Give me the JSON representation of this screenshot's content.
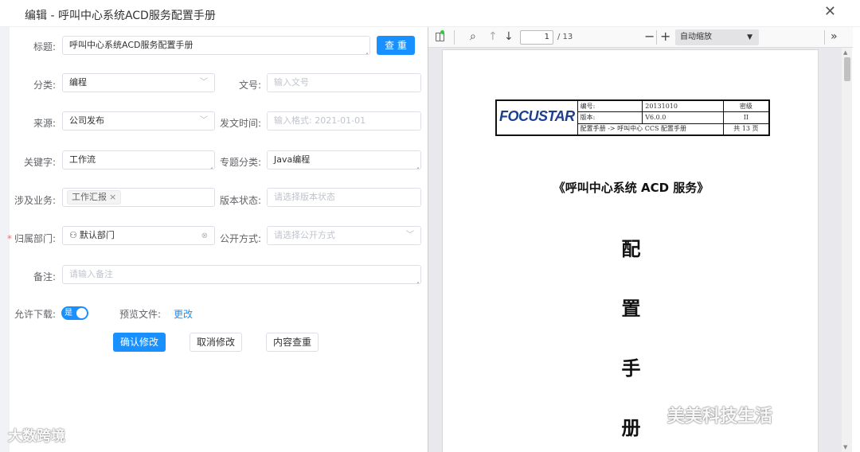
{
  "dialog": {
    "title": "编辑 - 呼叫中心系统ACD服务配置手册",
    "close_icon": "close-icon"
  },
  "form": {
    "title": {
      "label": "标题:",
      "value": "呼叫中心系统ACD服务配置手册",
      "button": "查 重"
    },
    "category": {
      "label": "分类:",
      "value": "编程"
    },
    "doc_no": {
      "label": "文号:",
      "placeholder": "输入文号"
    },
    "source": {
      "label": "来源:",
      "value": "公司发布"
    },
    "publish_time": {
      "label": "发文时间:",
      "placeholder": "输入格式: 2021-01-01"
    },
    "keywords": {
      "label": "关键字:",
      "value": "工作流"
    },
    "topic": {
      "label": "专题分类:",
      "value": "Java编程"
    },
    "business": {
      "label": "涉及业务:",
      "tag": "工作汇报"
    },
    "version_status": {
      "label": "版本状态:",
      "placeholder": "请选择版本状态"
    },
    "department": {
      "label": "归属部门:",
      "value": "默认部门",
      "required_mark": "*"
    },
    "visibility": {
      "label": "公开方式:",
      "placeholder": "请选择公开方式"
    },
    "remark": {
      "label": "备注:",
      "placeholder": "请输入备注"
    },
    "allow_download": {
      "label": "允许下载:",
      "toggle_text": "是",
      "on": true
    },
    "preview": {
      "label": "预览文件:",
      "link": "更改"
    },
    "buttons": {
      "confirm": "确认修改",
      "cancel": "取消修改",
      "recheck": "内容查重"
    }
  },
  "pdf": {
    "page_current": "1",
    "page_total": "/ 13",
    "zoom": "自动缩放",
    "header": {
      "logo": "FOCUSTAR",
      "row1_label": "编号:",
      "row1_value": "20131010",
      "row1_right": "密级",
      "row2_label": "版本:",
      "row2_value": "V6.0.0",
      "row2_right": "II",
      "row3_text": "配置手册 -> 呼叫中心 CCS 配置手册",
      "row3_right": "共 13 页"
    },
    "doc_title": "《呼叫中心系统 ACD 服务》",
    "vertical_chars": [
      "配",
      "置",
      "手",
      "册"
    ]
  },
  "watermarks": {
    "left": "大数跨境",
    "right": "美美科技生活"
  },
  "colors": {
    "primary": "#1890ff",
    "required": "#f56c6c"
  }
}
